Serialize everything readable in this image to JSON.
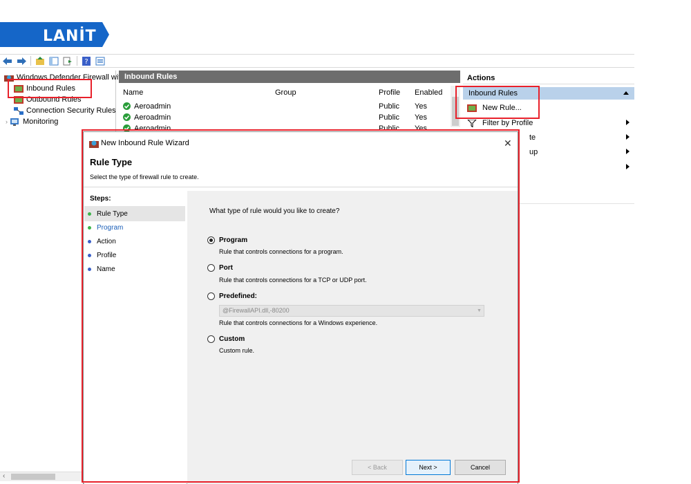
{
  "logo": {
    "text": "LANİT",
    "color": "#1566c8"
  },
  "tree": {
    "root": "Windows Defender Firewall with",
    "items": [
      "Inbound Rules",
      "Outbound Rules",
      "Connection Security Rules",
      "Monitoring"
    ]
  },
  "list": {
    "title": "Inbound Rules",
    "columns": [
      "Name",
      "Group",
      "Profile",
      "Enabled"
    ],
    "rows": [
      {
        "name": "Aeroadmin",
        "profile": "Public",
        "enabled": "Yes"
      },
      {
        "name": "Aeroadmin",
        "profile": "Public",
        "enabled": "Yes"
      },
      {
        "name": "Aeroadmin",
        "profile": "Public",
        "enabled": "Yes"
      }
    ]
  },
  "actions": {
    "title": "Actions",
    "section": "Inbound Rules",
    "items": [
      "New Rule...",
      "Filter by Profile",
      "te",
      "up"
    ]
  },
  "dialog": {
    "title": "New Inbound Rule Wizard",
    "heading": "Rule Type",
    "description": "Select the type of firewall rule to create.",
    "steps_label": "Steps:",
    "steps": [
      "Rule Type",
      "Program",
      "Action",
      "Profile",
      "Name"
    ],
    "question": "What type of rule would you like to create?",
    "options": [
      {
        "label": "Program",
        "desc": "Rule that controls connections for a program."
      },
      {
        "label": "Port",
        "desc": "Rule that controls connections for a TCP or UDP port."
      },
      {
        "label": "Predefined:",
        "desc": "Rule that controls connections for a Windows experience."
      },
      {
        "label": "Custom",
        "desc": "Custom rule."
      }
    ],
    "predefined_value": "@FirewallAPI.dll,-80200",
    "buttons": {
      "back": "< Back",
      "next": "Next >",
      "cancel": "Cancel"
    }
  },
  "colors": {
    "highlight": "#e8202a",
    "accent": "#0078d7",
    "step_done": "#3cb44b",
    "step_pending": "#3a5fc8"
  }
}
